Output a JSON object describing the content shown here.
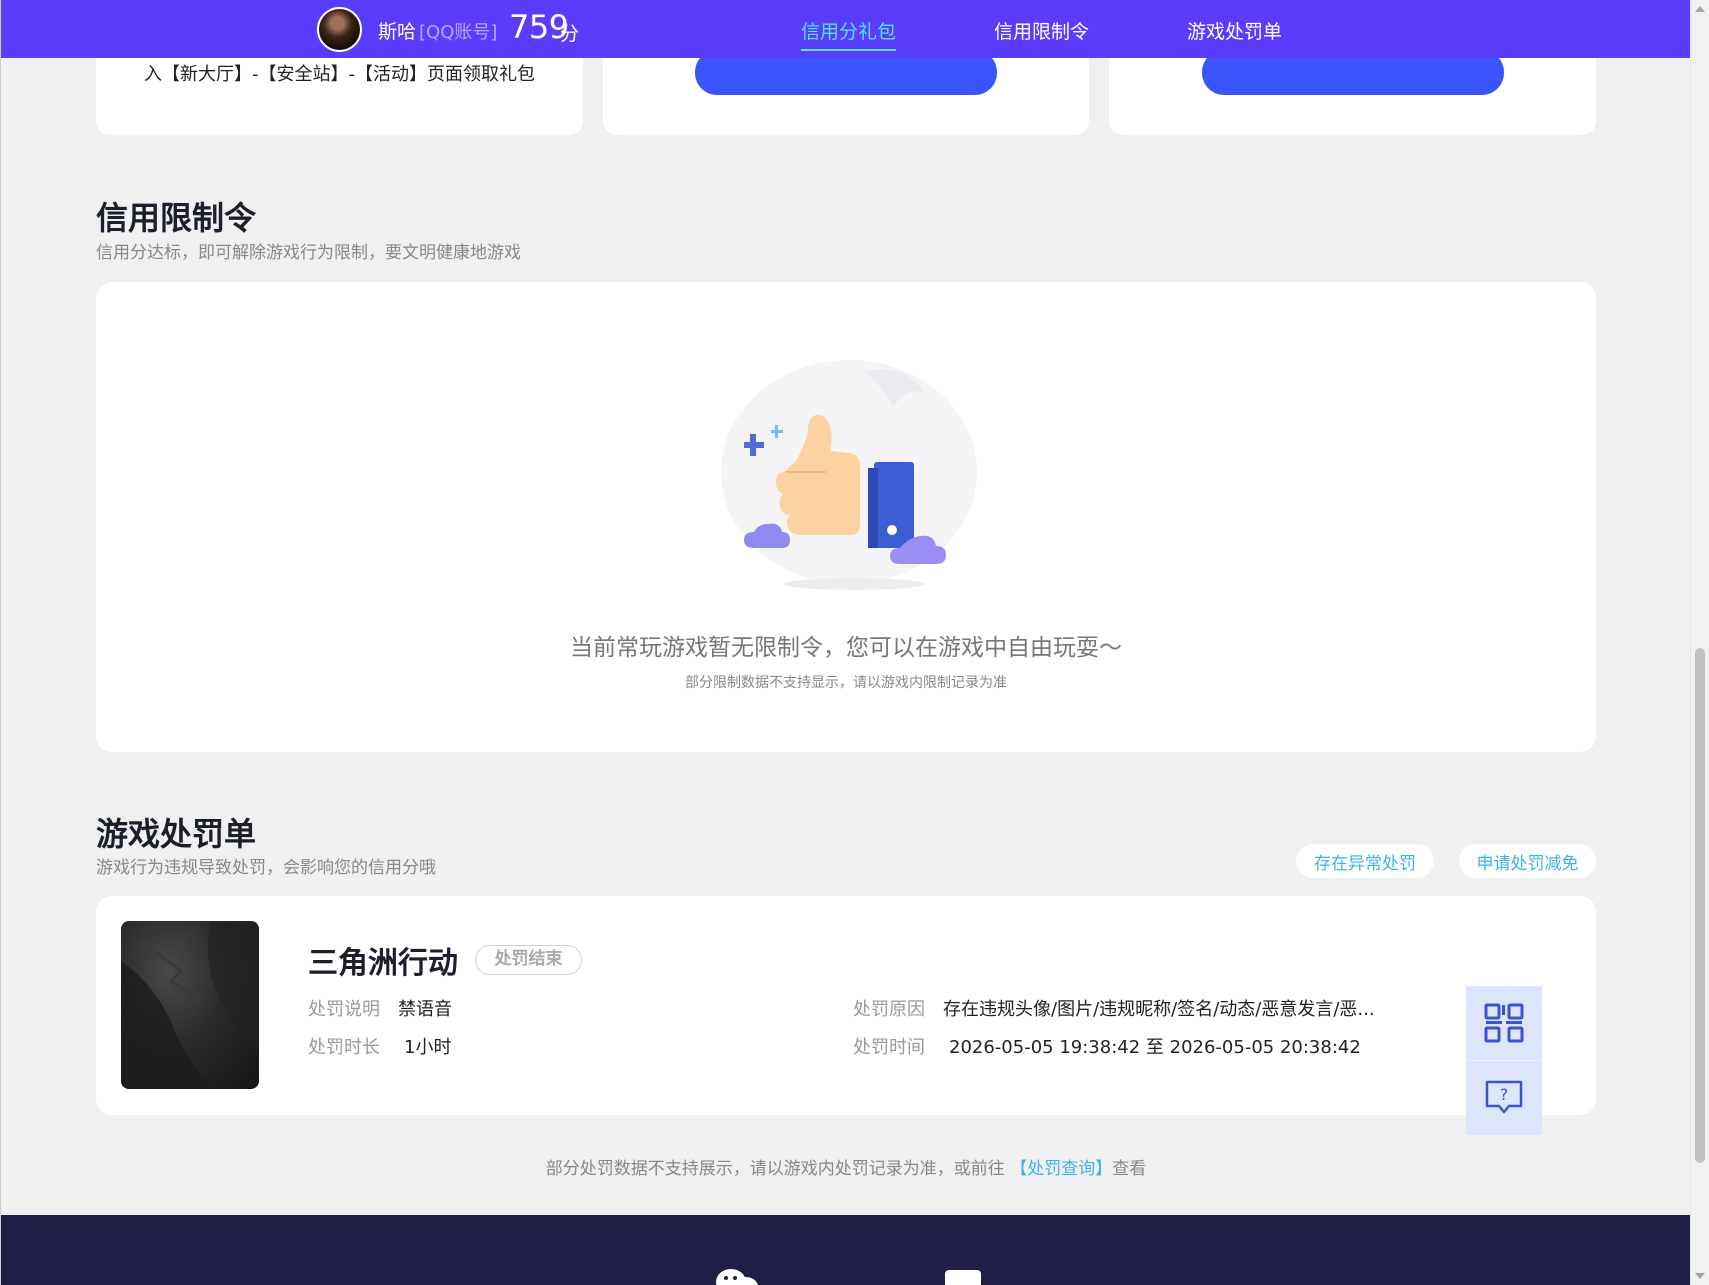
{
  "header": {
    "username": "斯哈",
    "account_type": "[QQ账号]",
    "score": "759",
    "score_unit": "分",
    "tabs": [
      {
        "label": "信用分礼包",
        "active": true
      },
      {
        "label": "信用限制令",
        "active": false
      },
      {
        "label": "游戏处罚单",
        "active": false
      }
    ]
  },
  "gift_cards": {
    "card1_instruction": "入【新大厅】-【安全站】-【活动】页面领取礼包"
  },
  "limit_section": {
    "title": "信用限制令",
    "subtitle": "信用分达标，即可解除游戏行为限制，要文明健康地游戏",
    "empty_message": "当前常玩游戏暂无限制令，您可以在游戏中自由玩耍～",
    "empty_note": "部分限制数据不支持显示，请以游戏内限制记录为准"
  },
  "penalty_section": {
    "title": "游戏处罚单",
    "subtitle": "游戏行为违规导致处罚，会影响您的信用分哦",
    "buttons": {
      "abnormal": "存在异常处罚",
      "reduce": "申请处罚减免"
    },
    "record": {
      "game_name": "三角洲行动",
      "status": "处罚结束",
      "desc_label": "处罚说明",
      "desc_value": "禁语音",
      "duration_label": "处罚时长",
      "duration_value": "1小时",
      "reason_label": "处罚原因",
      "reason_value": "存在违规头像/图片/违规昵称/签名/动态/恶意发言/恶...",
      "time_label": "处罚时间",
      "time_value": "2026-05-05 19:38:42 至 2026-05-05 20:38:42"
    },
    "footnote_prefix": "部分处罚数据不支持展示，请以游戏内处罚记录为准，或前往",
    "footnote_link": "【处罚查询】",
    "footnote_suffix": "查看"
  },
  "colors": {
    "nav_bg": "#5a3dfc",
    "active_tab": "#52e3f6",
    "primary_button": "#3a55fb",
    "link": "#3bb3ea",
    "footer_bg": "#1f1f45"
  }
}
